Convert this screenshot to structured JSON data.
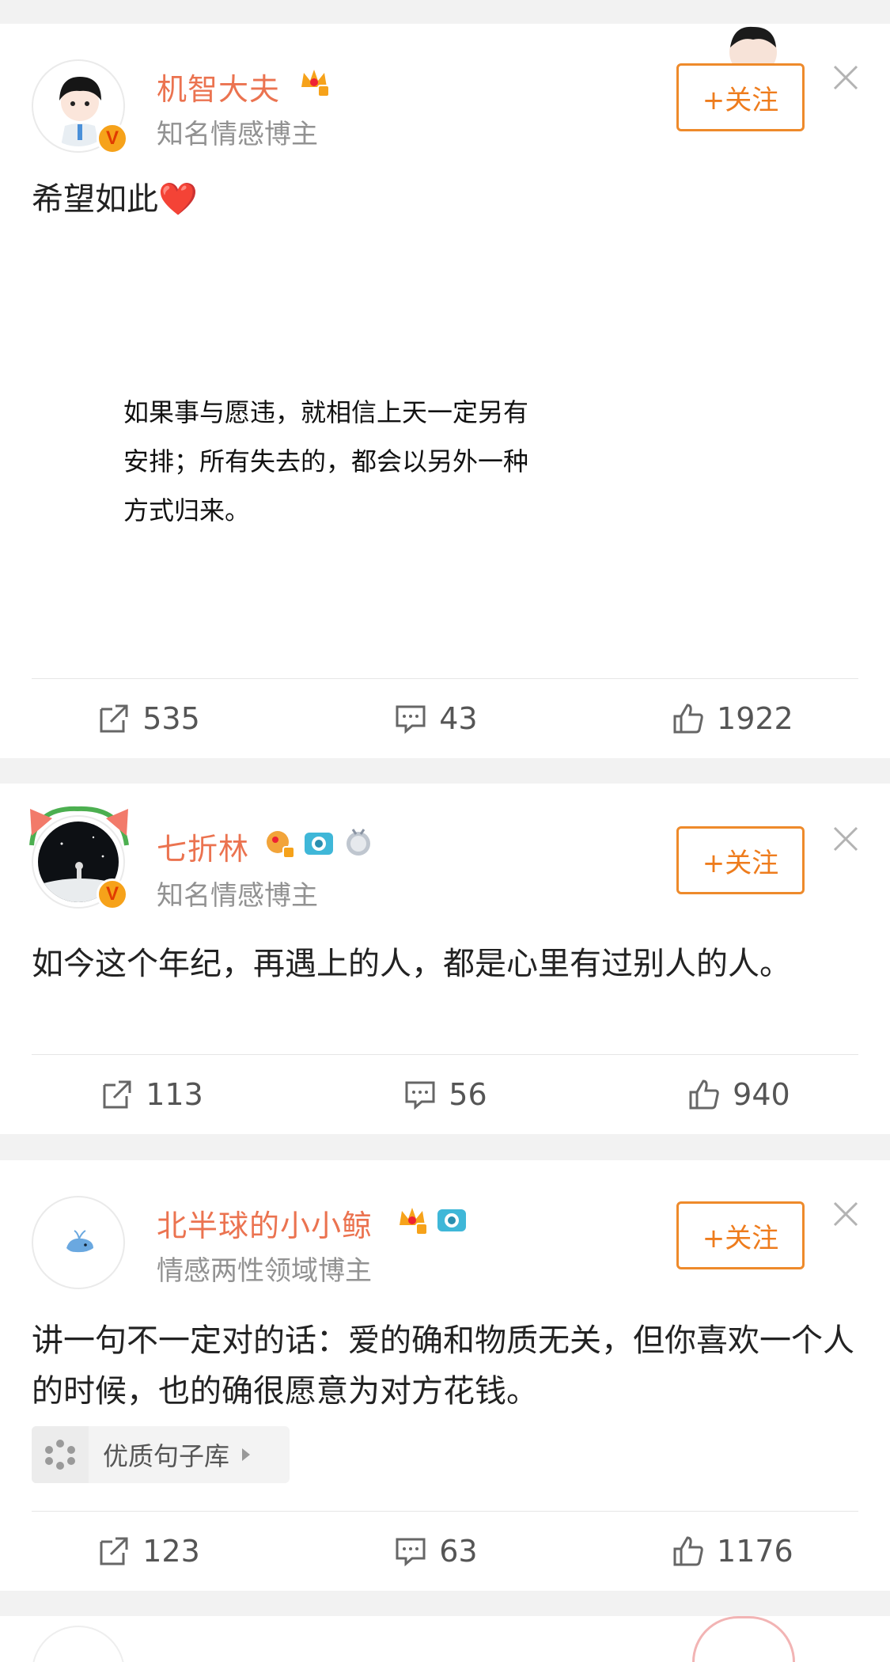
{
  "posts": [
    {
      "author": "机智大夫",
      "subtitle": "知名情感博主",
      "follow_label": "+关注",
      "text": "希望如此❤️",
      "image_text": "如果事与愿违，就相信上天一定另有安排；所有失去的，都会以另外一种方式归来。",
      "reposts": "535",
      "comments": "43",
      "likes": "1922"
    },
    {
      "author": "七折林",
      "subtitle": "知名情感博主",
      "follow_label": "+关注",
      "text": "如今这个年纪，再遇上的人，都是心里有过别人的人。",
      "reposts": "113",
      "comments": "56",
      "likes": "940"
    },
    {
      "author": "北半球的小小鲸",
      "subtitle": "情感两性领域博主",
      "follow_label": "+关注",
      "text": "讲一句不一定对的话：爱的确和物质无关，但你喜欢一个人的时候，也的确很愿意为对方花钱。",
      "tag": "优质句子库",
      "reposts": "123",
      "comments": "63",
      "likes": "1176"
    }
  ],
  "colors": {
    "name": "#eb7350",
    "follow": "#ee8a2b",
    "vip": "#f6a21a"
  },
  "icons": [
    "repost-icon",
    "comment-icon",
    "like-icon",
    "close-icon",
    "vip-crown-icon",
    "camera-icon"
  ]
}
